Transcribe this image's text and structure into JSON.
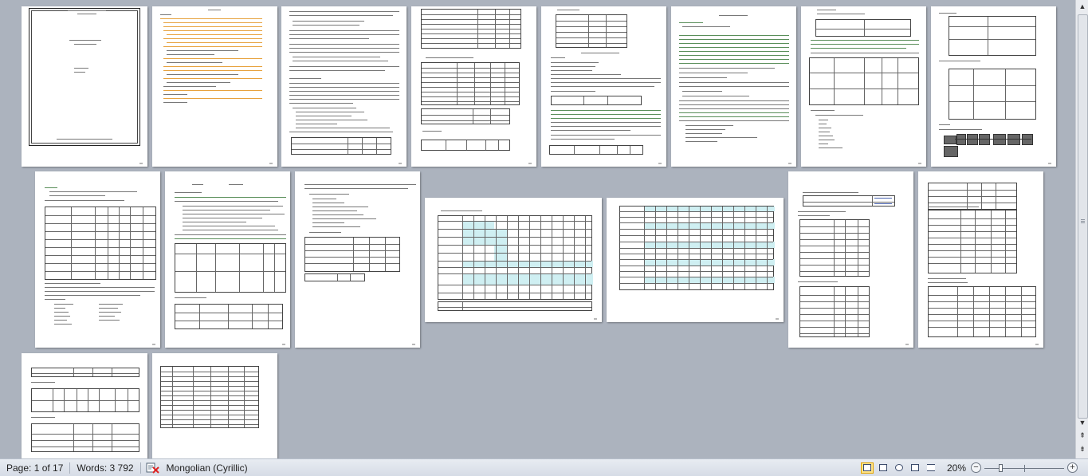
{
  "statusbar": {
    "page": "Page: 1 of 17",
    "words": "Words: 3 792",
    "language": "Mongolian (Cyrillic)",
    "zoom_level": "20%",
    "zoom_minus": "−",
    "zoom_plus": "+"
  },
  "scrollbar": {
    "up": "▲",
    "down": "▼",
    "prev_page": "⇞",
    "next_page": "⇟"
  },
  "colors": {
    "workspace_bg": "#acb3be",
    "page_bg": "#ffffff",
    "toc_dots": "#e7a23e",
    "green_text": "#5a8f5a",
    "table_highlight": "#cfeff2",
    "view_active": "#ffe48a"
  }
}
